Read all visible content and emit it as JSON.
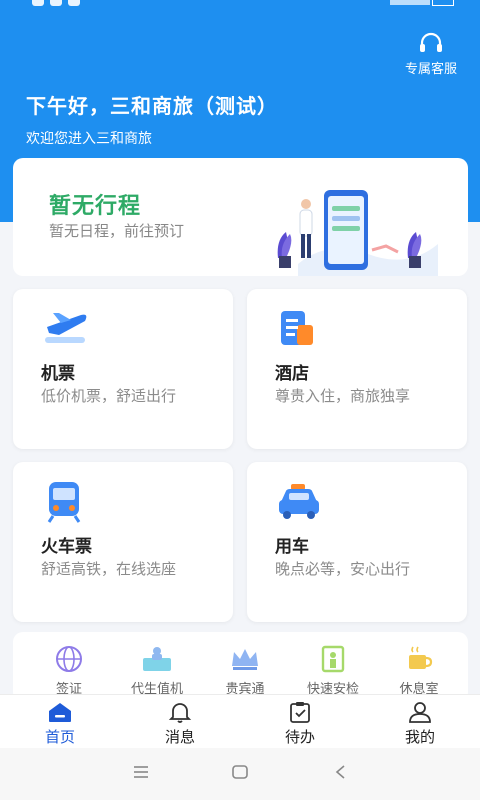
{
  "header": {
    "greeting": "下午好，三和商旅（测试）",
    "welcome": "欢迎您进入三和商旅",
    "service_label": "专属客服",
    "service_icon": "headset-icon"
  },
  "trip": {
    "title": "暂无行程",
    "subtitle": "暂无日程，前往预订"
  },
  "services": [
    {
      "name": "机票",
      "desc": "低价机票，舒适出行",
      "icon": "plane-icon"
    },
    {
      "name": "酒店",
      "desc": "尊贵入住，商旅独享",
      "icon": "hotel-icon"
    },
    {
      "name": "火车票",
      "desc": "舒适高铁，在线选座",
      "icon": "train-icon"
    },
    {
      "name": "用车",
      "desc": "晚点必等，安心出行",
      "icon": "car-icon"
    }
  ],
  "quick": [
    {
      "label": "签证",
      "icon": "globe-icon"
    },
    {
      "label": "代生值机",
      "icon": "checkin-icon"
    },
    {
      "label": "贵宾通",
      "icon": "crown-icon"
    },
    {
      "label": "快速安检",
      "icon": "security-gate-icon"
    },
    {
      "label": "休息室",
      "icon": "coffee-icon"
    }
  ],
  "tabs": [
    {
      "label": "首页",
      "icon": "home-icon",
      "active": true
    },
    {
      "label": "消息",
      "icon": "bell-icon",
      "active": false
    },
    {
      "label": "待办",
      "icon": "todo-icon",
      "active": false
    },
    {
      "label": "我的",
      "icon": "user-icon",
      "active": false
    }
  ],
  "colors": {
    "primary": "#1e8ff0",
    "trip_title": "#2eaa66",
    "tab_active": "#1e5bd8"
  }
}
